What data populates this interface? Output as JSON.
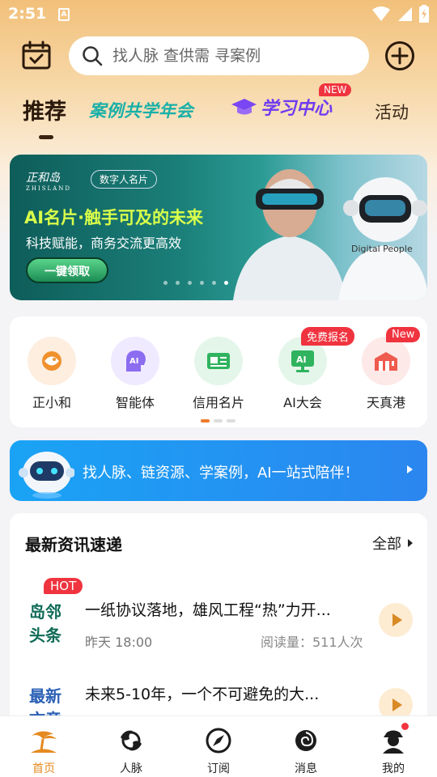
{
  "status_bar": {
    "time": "2:51",
    "notif_glyph": "A",
    "icons": [
      "wifi-icon",
      "signal-icon",
      "battery-icon"
    ]
  },
  "header": {
    "search_placeholder": "找人脉 查供需 寻案例",
    "icons": [
      "calendar-icon",
      "search-icon",
      "add-icon"
    ]
  },
  "tabs": [
    {
      "label": "推荐",
      "active": true
    },
    {
      "label": "案例共学年会"
    },
    {
      "label": "学习中心",
      "badge": "NEW"
    },
    {
      "label": "活动"
    }
  ],
  "banner": {
    "logo": "正和岛",
    "logo_sub": "ZHISLAND",
    "tag": "数字人名片",
    "title": "AI名片·触手可及的未来",
    "subtitle": "科技赋能，商务交流更高效",
    "cta": "一键领取",
    "robot_label": "Digital People",
    "slides": 6,
    "active_slide": 6
  },
  "quick_menu": {
    "items": [
      {
        "label": "正小和",
        "icon": "fish-icon",
        "bg": "#fdeee0",
        "fg": "#f0912e"
      },
      {
        "label": "智能体",
        "icon": "ai-head-icon",
        "bg": "#efeaff",
        "fg": "#8c6cf0"
      },
      {
        "label": "信用名片",
        "icon": "card-icon",
        "bg": "#e4f6ea",
        "fg": "#2fb35e"
      },
      {
        "label": "AI大会",
        "icon": "ai-screen-icon",
        "bg": "#e4f6ea",
        "fg": "#2fb35e",
        "badge": "免费报名"
      },
      {
        "label": "天真港",
        "icon": "building-icon",
        "bg": "#fde9e8",
        "fg": "#ef5b4e",
        "badge": "New"
      }
    ],
    "pages": 3,
    "active_page": 1
  },
  "ai_bar": {
    "text": "找人脉、链资源、学案例，AI一站式陪伴！"
  },
  "news": {
    "title": "最新资讯速递",
    "more": "全部",
    "items": [
      {
        "logo": [
          "岛邻",
          "头条"
        ],
        "logo_color": "#0f6b57",
        "badge": "HOT",
        "headline": "一纸协议落地，雄风工程“热”力开...",
        "date": "昨天 18:00",
        "reads": "阅读量：511人次"
      },
      {
        "logo": [
          "最新",
          "文章"
        ],
        "logo_color": "#2a5fb5",
        "headline": "未来5-10年，一个不可避免的大..."
      }
    ]
  },
  "bottom_nav": [
    {
      "label": "首页",
      "icon": "island-icon",
      "active": true
    },
    {
      "label": "人脉",
      "icon": "fish-icon"
    },
    {
      "label": "订阅",
      "icon": "compass-icon"
    },
    {
      "label": "消息",
      "icon": "shell-icon"
    },
    {
      "label": "我的",
      "icon": "profile-icon",
      "dot": true
    }
  ],
  "colors": {
    "accent": "#e58a1f",
    "badge_red": "#f0343f",
    "ai_blue": "#1aa3f5"
  }
}
